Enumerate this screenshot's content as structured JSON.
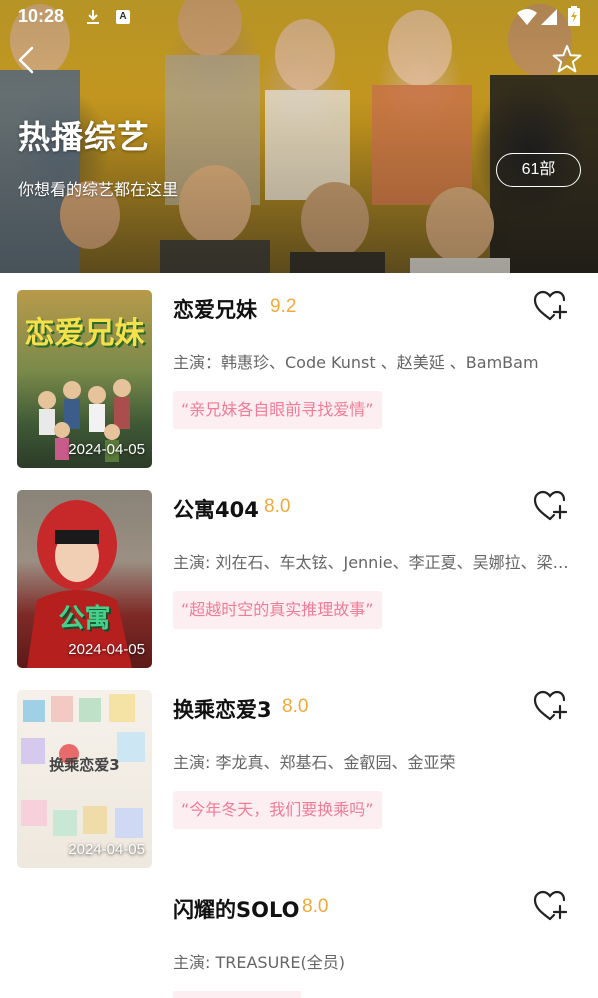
{
  "status_bar": {
    "time": "10:28",
    "icons": [
      "download-icon",
      "a-badge-icon",
      "wifi-icon",
      "signal-icon",
      "battery-icon"
    ]
  },
  "header": {
    "title": "热播综艺",
    "subtitle": "你想看的综艺都在这里",
    "count": "61部",
    "back_icon": "chevron-left-icon",
    "favorite_icon": "star-outline-icon"
  },
  "shows": [
    {
      "title": "恋爱兄妹",
      "rating": "9.2",
      "cast": "主演：韩惠珍、Code Kunst 、赵美延 、BamBam",
      "tagline": "“亲兄妹各自眼前寻找爱情”",
      "date": "2024-04-05",
      "poster_text": "恋爱兄妹"
    },
    {
      "title": "公寓404",
      "rating": "8.0",
      "cast": "主演: 刘在石、车太铉、Jennie、李正夏、吴娜拉、梁世灿",
      "tagline": "“超越时空的真实推理故事”",
      "date": "2024-04-05",
      "poster_text": "公寓"
    },
    {
      "title": "换乘恋爱3",
      "rating": "8.0",
      "cast": "主演: 李龙真、郑基石、金叡园、金亚荣",
      "tagline": "“今年冬天，我们要换乘吗”",
      "date": "2024-04-05",
      "poster_text": "换乘恋爱3"
    },
    {
      "title": "闪耀的SOLO",
      "rating": "8.0",
      "cast": "主演: TREASURE(全员)",
      "tagline": "",
      "date": "",
      "poster_text": ""
    }
  ],
  "colors": {
    "rating": "#f2a93b",
    "tagline_text": "#f07c97",
    "tagline_bg": "#fdeef1",
    "hero_yellow": "#d6ad2b"
  }
}
